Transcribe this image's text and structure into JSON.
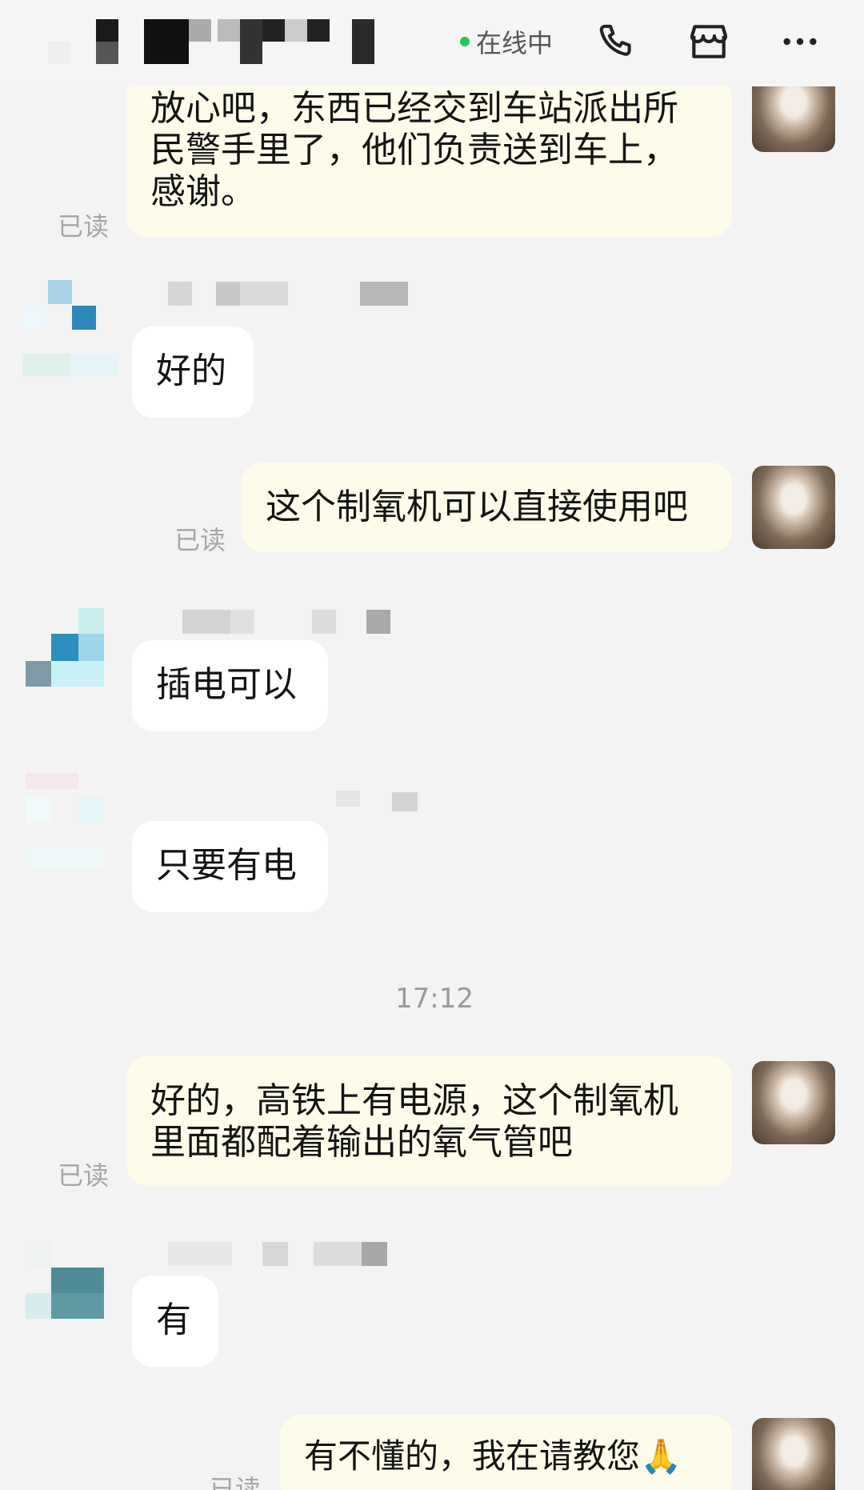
{
  "header": {
    "status_text": "在线中",
    "icons": [
      "phone-icon",
      "shop-icon",
      "more-icon"
    ],
    "online_color": "#29c45a"
  },
  "messages": [
    {
      "side": "self",
      "text": "放心吧，东西已经交到车站派出所民警手里了，他们负责送到车上，感谢。",
      "read": "已读"
    },
    {
      "side": "other",
      "text": "好的"
    },
    {
      "side": "self",
      "text": "这个制氧机可以直接使用吧",
      "read": "已读"
    },
    {
      "side": "other",
      "text": "插电可以"
    },
    {
      "side": "other",
      "text": "只要有电"
    },
    {
      "side": "self",
      "text": "好的，高铁上有电源，这个制氧机里面都配着输出的氧气管吧",
      "read": "已读"
    },
    {
      "side": "other",
      "text": "有"
    },
    {
      "side": "self",
      "text": "有不懂的，我在请教您🙏",
      "read": "已读"
    }
  ],
  "timestamp": "17:12",
  "colors": {
    "self_bubble": "#fdfbea",
    "other_bubble": "#ffffff",
    "background": "#f3f3f3"
  }
}
